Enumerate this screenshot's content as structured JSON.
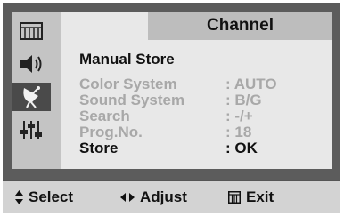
{
  "header": {
    "title": "Channel"
  },
  "sidebar": {
    "items": [
      {
        "icon": "picture-icon",
        "active": false
      },
      {
        "icon": "sound-icon",
        "active": false
      },
      {
        "icon": "channel-icon",
        "active": true
      },
      {
        "icon": "setup-icon",
        "active": false
      }
    ]
  },
  "menu": {
    "title": "Manual Store",
    "rows": [
      {
        "label": "Color System",
        "value": ": AUTO",
        "selected": false
      },
      {
        "label": "Sound System",
        "value": ": B/G",
        "selected": false
      },
      {
        "label": "Search",
        "value": ":  -/+",
        "selected": false
      },
      {
        "label": "Prog.No.",
        "value": ":  18",
        "selected": false
      },
      {
        "label": "Store",
        "value": ":  OK",
        "selected": true
      }
    ]
  },
  "footer": {
    "select_label": "Select",
    "adjust_label": "Adjust",
    "exit_label": "Exit"
  },
  "colors": {
    "frame": "#5c5c5c",
    "panel": "#e8e8e8",
    "header_bar": "#bdbdbd",
    "dimmed_text": "#a8a8a8",
    "active_text": "#111111"
  }
}
